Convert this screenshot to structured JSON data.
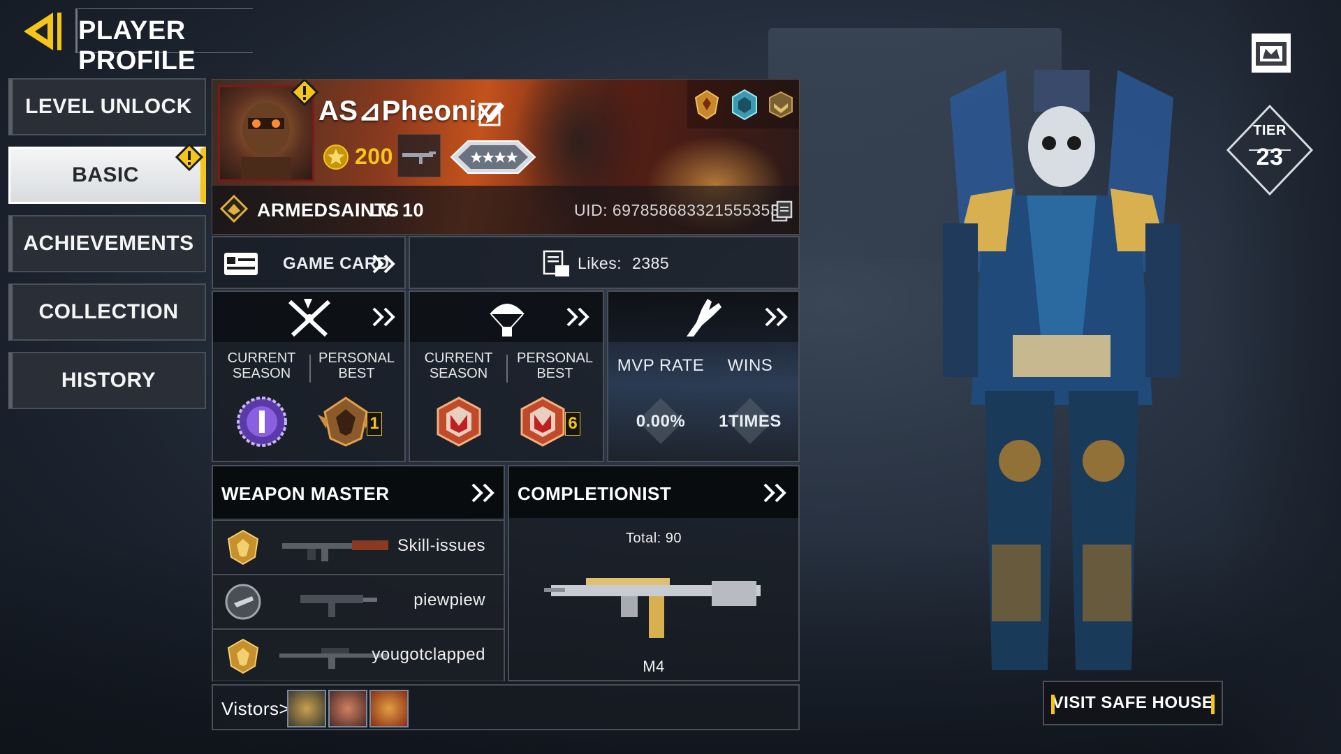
{
  "header": {
    "title": "PLAYER PROFILE"
  },
  "nav": {
    "items": [
      {
        "label": "LEVEL UNLOCK",
        "active": false
      },
      {
        "label": "BASIC",
        "active": true
      },
      {
        "label": "ACHIEVEMENTS",
        "active": false
      },
      {
        "label": "COLLECTION",
        "active": false
      },
      {
        "label": "HISTORY",
        "active": false
      }
    ]
  },
  "profile": {
    "name": "AS⊿Pheonix",
    "honor_points": "200",
    "clan_name": "ARMEDSAINTS",
    "level": "LV. 10",
    "uid": "UID: 6978586833215553537"
  },
  "game_card": {
    "label": "GAME CARD"
  },
  "likes": {
    "label": "Likes:",
    "value": "2385"
  },
  "mp_stats": {
    "current_label": "CURRENT\nSEASON",
    "best_label": "PERSONAL\nBEST",
    "best_rank_number": "1"
  },
  "br_stats": {
    "current_label": "CURRENT\nSEASON",
    "best_label": "PERSONAL\nBEST",
    "best_rank_number": "6"
  },
  "mvp_stats": {
    "mvp_label": "MVP RATE",
    "wins_label": "WINS",
    "mvp_value": "0.00%",
    "wins_value": "1TIMES"
  },
  "weapon_master": {
    "title": "WEAPON MASTER",
    "rows": [
      {
        "label": "Skill-issues"
      },
      {
        "label": "piewpiew"
      },
      {
        "label": "yougotclapped"
      }
    ]
  },
  "completionist": {
    "title": "COMPLETIONIST",
    "total": "Total: 90",
    "weapon": "M4"
  },
  "visitors": {
    "label": "Vistors>"
  },
  "tier": {
    "label": "TIER",
    "value": "23"
  },
  "safehouse": {
    "label": "VISIT SAFE HOUSE"
  },
  "colors": {
    "accent": "#f5c518",
    "panel": "#181c22",
    "border": "#4a4f57"
  }
}
